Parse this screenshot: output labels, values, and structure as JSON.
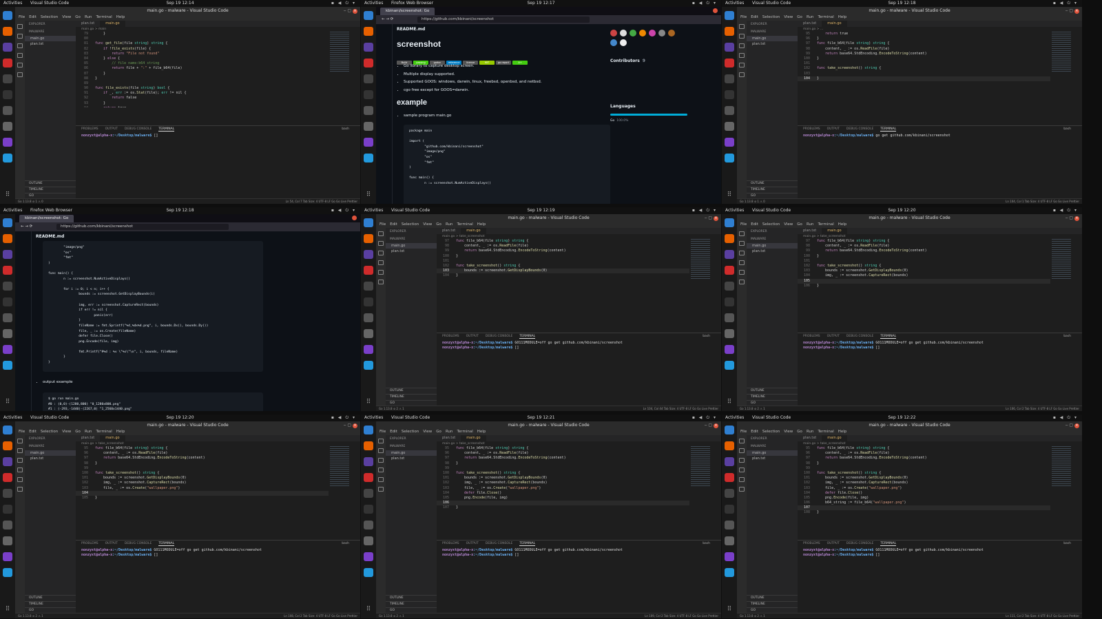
{
  "tiles": [
    {
      "type": "vscode",
      "topbar": {
        "activities": "Activities",
        "app": "Visual Studio Code",
        "clock": "Sep 19 12:14"
      },
      "title": "main.go - malware - Visual Studio Code",
      "tab_active": "main.go",
      "tab_other": "plan.txt",
      "breadcrumb": "main.go > main",
      "file_selected": "main.go",
      "lines": [
        {
          "n": "79",
          "t": "    }"
        },
        {
          "n": "80",
          "t": ""
        },
        {
          "n": "81",
          "t": "func get_file(file string) string {"
        },
        {
          "n": "82",
          "t": "    if !file_exists(file) {"
        },
        {
          "n": "83",
          "t": "        return \"File not found\""
        },
        {
          "n": "84",
          "t": "    } else {"
        },
        {
          "n": "85",
          "t": "        // file name:b64 string"
        },
        {
          "n": "86",
          "t": "        return file + \":\" + file_b64(file)"
        },
        {
          "n": "87",
          "t": "    }"
        },
        {
          "n": "88",
          "t": "}"
        },
        {
          "n": "89",
          "t": ""
        },
        {
          "n": "90",
          "t": "func file_exists(file string) bool {"
        },
        {
          "n": "91",
          "t": "    if _, err := os.Stat(file); err != nil {"
        },
        {
          "n": "92",
          "t": "        return false"
        },
        {
          "n": "93",
          "t": "    }"
        },
        {
          "n": "94",
          "t": "    return true"
        }
      ],
      "cur": -1,
      "problems": "1",
      "terminal": [
        {
          "p": "nonzyxt@alpha-x",
          "d": ":~/Desktop/malware$",
          "c": " []"
        }
      ],
      "status_left": "Go 1.13.8  ⊘ 1 ⚠ 0",
      "status_right": "Ln 54, Col 7   Tab Size: 4   UTF-8   LF   Go   Go Live   Prettier"
    },
    {
      "type": "firefox",
      "topbar": {
        "activities": "Activities",
        "app": "Firefox Web Browser",
        "clock": "Sep 19 12:17"
      },
      "tab": "kbinani/screenshot: Go",
      "url": "https://github.com/kbinani/screenshot",
      "view": "top"
    },
    {
      "type": "vscode",
      "topbar": {
        "activities": "Activities",
        "app": "Visual Studio Code",
        "clock": "Sep 19 12:18"
      },
      "title": "main.go - malware - Visual Studio Code",
      "tab_active": "main.go",
      "tab_other": "plan.txt",
      "breadcrumb": "main.go > ...",
      "file_selected": "main.go",
      "lines": [
        {
          "n": "95",
          "t": "    return true"
        },
        {
          "n": "96",
          "t": "}"
        },
        {
          "n": "97",
          "t": "func file_b64(file string) string {"
        },
        {
          "n": "98",
          "t": "    content, _ := os.ReadFile(file)"
        },
        {
          "n": "99",
          "t": "    return base64.StdEncoding.EncodeToString(content)"
        },
        {
          "n": "100",
          "t": "}"
        },
        {
          "n": "101",
          "t": ""
        },
        {
          "n": "102",
          "t": "func take_screenshot() string {"
        },
        {
          "n": "103",
          "t": ""
        },
        {
          "n": "104",
          "t": "}"
        }
      ],
      "cur": 9,
      "problems": "1",
      "terminal": [
        {
          "p": "nonzyxt@alpha-x",
          "d": ":~/Desktop/malware$",
          "c": " go get github.com/kbinani/screenshot"
        }
      ],
      "status_left": "Go 1.13.8  ⊘ 1 ⚠ 0",
      "status_right": "Ln 104, Col 1   Tab Size: 4   UTF-8   LF   Go   Go Live   Prettier"
    },
    {
      "type": "firefox",
      "topbar": {
        "activities": "Activities",
        "app": "Firefox Web Browser",
        "clock": "Sep 19 12:18"
      },
      "tab": "kbinani/screenshot: Go",
      "url": "https://github.com/kbinani/screenshot",
      "view": "scrolled"
    },
    {
      "type": "vscode",
      "topbar": {
        "activities": "Activities",
        "app": "Visual Studio Code",
        "clock": "Sep 19 12:19"
      },
      "title": "main.go - malware - Visual Studio Code",
      "tab_active": "main.go",
      "tab_other": "plan.txt",
      "breadcrumb": "main.go > take_screenshot",
      "file_selected": "main.go",
      "lines": [
        {
          "n": "97",
          "t": "func file_b64(file string) string {"
        },
        {
          "n": "98",
          "t": "    content, _ := os.ReadFile(file)"
        },
        {
          "n": "99",
          "t": "    return base64.StdEncoding.EncodeToString(content)"
        },
        {
          "n": "100",
          "t": "}"
        },
        {
          "n": "101",
          "t": ""
        },
        {
          "n": "102",
          "t": "func take_screenshot() string {"
        },
        {
          "n": "103",
          "t": "    bounds := screenshot.GetDisplayBounds(0)"
        },
        {
          "n": "104",
          "t": "}"
        }
      ],
      "cur": 6,
      "problems": "2",
      "terminal": [
        {
          "p": "nonzyxt@alpha-x",
          "d": ":~/Desktop/malware$",
          "c": " GO111MODULE=off go get github.com/kbinani/screenshot"
        },
        {
          "p": "nonzyxt@alpha-x",
          "d": ":~/Desktop/malware$",
          "c": " []"
        }
      ],
      "status_left": "Go 1.13.8  ⊘ 2 ⚠ 1",
      "status_right": "Ln 104, Col 44   Tab Size: 4   UTF-8   LF   Go   Go Live   Prettier"
    },
    {
      "type": "vscode",
      "topbar": {
        "activities": "Activities",
        "app": "Visual Studio Code",
        "clock": "Sep 19 12:20"
      },
      "title": "main.go - malware - Visual Studio Code",
      "tab_active": "main.go",
      "tab_other": "plan.txt",
      "breadcrumb": "main.go > take_screenshot",
      "file_selected": "main.go",
      "lines": [
        {
          "n": "97",
          "t": "func file_b64(file string) string {"
        },
        {
          "n": "98",
          "t": "    content, _ := os.ReadFile(file)"
        },
        {
          "n": "99",
          "t": "    return base64.StdEncoding.EncodeToString(content)"
        },
        {
          "n": "100",
          "t": "}"
        },
        {
          "n": "101",
          "t": ""
        },
        {
          "n": "102",
          "t": "func take_screenshot() string {"
        },
        {
          "n": "103",
          "t": "    bounds := screenshot.GetDisplayBounds(0)"
        },
        {
          "n": "104",
          "t": "    img, _ := screenshot.CaptureRect(bounds)"
        },
        {
          "n": "105",
          "t": ""
        },
        {
          "n": "106",
          "t": "}"
        }
      ],
      "cur": 8,
      "problems": "2",
      "terminal": [
        {
          "p": "nonzyxt@alpha-x",
          "d": ":~/Desktop/malware$",
          "c": " GO111MODULE=off go get github.com/kbinani/screenshot"
        },
        {
          "p": "nonzyxt@alpha-x",
          "d": ":~/Desktop/malware$",
          "c": " []"
        }
      ],
      "status_left": "Go 1.13.8  ⊘ 2 ⚠ 1",
      "status_right": "Ln 106, Col 2   Tab Size: 4   UTF-8   LF   Go   Go Live   Prettier"
    },
    {
      "type": "vscode",
      "topbar": {
        "activities": "Activities",
        "app": "Visual Studio Code",
        "clock": "Sep 19 12:20"
      },
      "title": "main.go - malware - Visual Studio Code",
      "tab_active": "main.go",
      "tab_other": "plan.txt",
      "breadcrumb": "main.go > take_screenshot",
      "file_selected": "main.go",
      "lines": [
        {
          "n": "95",
          "t": "func file_b64(file string) string {"
        },
        {
          "n": "96",
          "t": "    content, _ := os.ReadFile(file)"
        },
        {
          "n": "97",
          "t": "    return base64.StdEncoding.EncodeToString(content)"
        },
        {
          "n": "98",
          "t": "}"
        },
        {
          "n": "99",
          "t": ""
        },
        {
          "n": "100",
          "t": "func take_screenshot() string {"
        },
        {
          "n": "101",
          "t": "    bounds := screenshot.GetDisplayBounds(0)"
        },
        {
          "n": "102",
          "t": "    img, _ := screenshot.CaptureRect(bounds)"
        },
        {
          "n": "103",
          "t": "    file, _ := os.Create(\"wallpaper.png\")"
        },
        {
          "n": "104",
          "t": ""
        },
        {
          "n": "105",
          "t": "}"
        }
      ],
      "cur": 9,
      "problems": "2",
      "terminal": [
        {
          "p": "nonzyxt@alpha-x",
          "d": ":~/Desktop/malware$",
          "c": " GO111MODULE=off go get github.com/kbinani/screenshot"
        },
        {
          "p": "nonzyxt@alpha-x",
          "d": ":~/Desktop/malware$",
          "c": " []"
        }
      ],
      "status_left": "Go 1.13.8  ⊘ 2 ⚠ 1",
      "status_right": "Ln 108, Col 2   Tab Size: 4   UTF-8   LF   Go   Go Live   Prettier"
    },
    {
      "type": "vscode",
      "topbar": {
        "activities": "Activities",
        "app": "Visual Studio Code",
        "clock": "Sep 19 12:21"
      },
      "title": "main.go - malware - Visual Studio Code",
      "tab_active": "main.go",
      "tab_other": "plan.txt",
      "breadcrumb": "main.go > take_screenshot",
      "file_selected": "main.go",
      "lines": [
        {
          "n": "95",
          "t": "func file_b64(file string) string {"
        },
        {
          "n": "96",
          "t": "    content, _ := os.ReadFile(file)"
        },
        {
          "n": "97",
          "t": "    return base64.StdEncoding.EncodeToString(content)"
        },
        {
          "n": "98",
          "t": "}"
        },
        {
          "n": "99",
          "t": ""
        },
        {
          "n": "100",
          "t": "func take_screenshot() string {"
        },
        {
          "n": "101",
          "t": "    bounds := screenshot.GetDisplayBounds(0)"
        },
        {
          "n": "102",
          "t": "    img, _ := screenshot.CaptureRect(bounds)"
        },
        {
          "n": "103",
          "t": "    file, _ := os.Create(\"wallpaper.png\")"
        },
        {
          "n": "104",
          "t": "    defer file.Close()"
        },
        {
          "n": "105",
          "t": "    png.Encode(file, img)"
        },
        {
          "n": "106",
          "t": ""
        },
        {
          "n": "107",
          "t": "}"
        }
      ],
      "cur": 11,
      "problems": "2",
      "terminal": [
        {
          "p": "nonzyxt@alpha-x",
          "d": ":~/Desktop/malware$",
          "c": " GO111MODULE=off go get github.com/kbinani/screenshot"
        },
        {
          "p": "nonzyxt@alpha-x",
          "d": ":~/Desktop/malware$",
          "c": " []"
        }
      ],
      "status_left": "Go 1.13.8  ⊘ 2 ⚠ 1",
      "status_right": "Ln 109, Col 2   Tab Size: 4   UTF-8   LF   Go   Go Live   Prettier"
    },
    {
      "type": "vscode",
      "topbar": {
        "activities": "Activities",
        "app": "Visual Studio Code",
        "clock": "Sep 19 12:22"
      },
      "title": "main.go - malware - Visual Studio Code",
      "tab_active": "main.go",
      "tab_other": "plan.txt",
      "breadcrumb": "main.go > take_screenshot",
      "file_selected": "main.go",
      "lines": [
        {
          "n": "95",
          "t": "func file_b64(file string) string {"
        },
        {
          "n": "96",
          "t": "    content, _ := os.ReadFile(file)"
        },
        {
          "n": "97",
          "t": "    return base64.StdEncoding.EncodeToString(content)"
        },
        {
          "n": "98",
          "t": "}"
        },
        {
          "n": "99",
          "t": ""
        },
        {
          "n": "100",
          "t": "func take_screenshot() string {"
        },
        {
          "n": "101",
          "t": "    bounds := screenshot.GetDisplayBounds(0)"
        },
        {
          "n": "102",
          "t": "    img, _ := screenshot.CaptureRect(bounds)"
        },
        {
          "n": "103",
          "t": "    file, _ := os.Create(\"wallpaper.png\")"
        },
        {
          "n": "104",
          "t": "    defer file.Close()"
        },
        {
          "n": "105",
          "t": "    png.Encode(file, img)"
        },
        {
          "n": "106",
          "t": "    b64_string := file_b64(\"wallpaper.png\")"
        },
        {
          "n": "107",
          "t": ""
        },
        {
          "n": "108",
          "t": "}"
        }
      ],
      "cur": 12,
      "problems": "2",
      "terminal": [
        {
          "p": "nonzyxt@alpha-x",
          "d": ":~/Desktop/malware$",
          "c": " GO111MODULE=off go get github.com/kbinani/screenshot"
        },
        {
          "p": "nonzyxt@alpha-x",
          "d": ":~/Desktop/malware$",
          "c": " []"
        }
      ],
      "status_left": "Go 1.13.8  ⊘ 2 ⚠ 1",
      "status_right": "Ln 111, Col 2   Tab Size: 4   UTF-8   LF   Go   Go Live   Prettier"
    }
  ],
  "vscode_common": {
    "menu": [
      "File",
      "Edit",
      "Selection",
      "View",
      "Go",
      "Run",
      "Terminal",
      "Help"
    ],
    "explorer": "EXPLORER",
    "folder": "MALWARE",
    "file2": "plan.txt",
    "outline": "OUTLINE",
    "timeline": "TIMELINE",
    "go": "GO",
    "panel_tabs": [
      "PROBLEMS",
      "OUTPUT",
      "DEBUG CONSOLE",
      "TERMINAL"
    ],
    "shell": "bash"
  },
  "github": {
    "readme": "README.md",
    "title": "screenshot",
    "badges": [
      "Build",
      "passing",
      "godoc",
      "reference",
      "license",
      "MIT",
      "go report",
      "A+"
    ],
    "bullets": [
      "Go library to capture desktop screen.",
      "Multiple display supported.",
      "Supported GOOS: windows, darwin, linux, freebsd, openbsd, and netbsd.",
      "cgo free except for GOOS=darwin."
    ],
    "example": "example",
    "sample": "sample program main.go",
    "code_top": "package main\n\nimport (\n\t\"github.com/kbinani/screenshot\"\n\t\"image/png\"\n\t\"os\"\n\t\"fmt\"\n)\n\nfunc main() {\n\tn := screenshot.NumActiveDisplays()",
    "code_scrolled": "\t\"image/png\"\n\t\"os\"\n\t\"fmt\"\n)\n\nfunc main() {\n\tn := screenshot.NumActiveDisplays()\n\n\tfor i := 0; i < n; i++ {\n\t\tbounds := screenshot.GetDisplayBounds(i)\n\n\t\timg, err := screenshot.CaptureRect(bounds)\n\t\tif err != nil {\n\t\t\tpanic(err)\n\t\t}\n\t\tfileName := fmt.Sprintf(\"%d_%dx%d.png\", i, bounds.Dx(), bounds.Dy())\n\t\tfile, _ := os.Create(fileName)\n\t\tdefer file.Close()\n\t\tpng.Encode(file, img)\n\n\t\tfmt.Printf(\"#%d : %v \\\"%s\\\"\\n\", i, bounds, fileName)\n\t}\n}",
    "output_example": "output example",
    "output_code": "$ go run main.go\n#0 : (0,0)-(1280,800) \"0_1280x800.png\"\n#1 : (-293,-1440)-(2267,0) \"1_2560x1440.png\"",
    "contributors": "Contributors",
    "contributors_count": "9",
    "languages": "Languages",
    "lang": "Go",
    "lang_pct": "100.0%"
  },
  "colors": {
    "vscode_bg": "#1e1e1e",
    "github_bg": "#0d1117",
    "prompt_user": "#b788d4",
    "prompt_path": "#6ab0f3",
    "accent_blue": "#00add8"
  }
}
